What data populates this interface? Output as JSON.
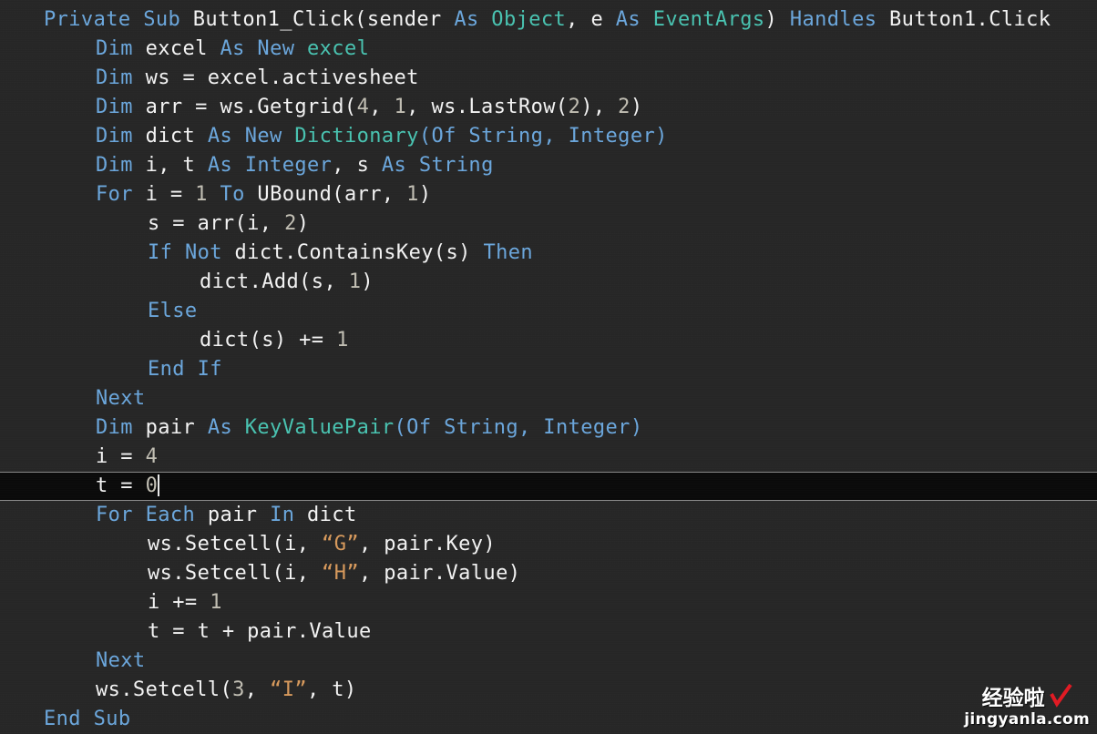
{
  "editor": {
    "language": "Visual Basic .NET",
    "background_color": "#262626",
    "default_text_color": "#f2f2f2",
    "keyword_color": "#6ba7dd",
    "type_color": "#49c3b1",
    "string_color": "#d89a5c",
    "number_color": "#c2bfb4",
    "current_line_background": "#0a0a0a",
    "current_line_border_color": "#8a8a8a",
    "caret_line_index": 15,
    "caret_column_after": "t = 0"
  },
  "code_lines": [
    {
      "indent": 0,
      "tokens": [
        {
          "t": "kw",
          "s": "Private"
        },
        {
          "t": "op",
          "s": " "
        },
        {
          "t": "kw",
          "s": "Sub"
        },
        {
          "t": "op",
          "s": " "
        },
        {
          "t": "id",
          "s": "Button1_Click(sender"
        },
        {
          "t": "op",
          "s": " "
        },
        {
          "t": "kw",
          "s": "As"
        },
        {
          "t": "op",
          "s": " "
        },
        {
          "t": "type",
          "s": "Object"
        },
        {
          "t": "id",
          "s": ", e"
        },
        {
          "t": "op",
          "s": " "
        },
        {
          "t": "kw",
          "s": "As"
        },
        {
          "t": "op",
          "s": " "
        },
        {
          "t": "type",
          "s": "EventArgs"
        },
        {
          "t": "id",
          "s": ")"
        },
        {
          "t": "op",
          "s": " "
        },
        {
          "t": "kw",
          "s": "Handles"
        },
        {
          "t": "op",
          "s": " "
        },
        {
          "t": "id",
          "s": "Button1.Click"
        }
      ]
    },
    {
      "indent": 1,
      "tokens": [
        {
          "t": "kw",
          "s": "Dim"
        },
        {
          "t": "id",
          "s": " excel "
        },
        {
          "t": "kw",
          "s": "As"
        },
        {
          "t": "op",
          "s": " "
        },
        {
          "t": "kw",
          "s": "New"
        },
        {
          "t": "op",
          "s": " "
        },
        {
          "t": "type",
          "s": "excel"
        }
      ]
    },
    {
      "indent": 1,
      "tokens": [
        {
          "t": "kw",
          "s": "Dim"
        },
        {
          "t": "id",
          "s": " ws = excel.activesheet"
        }
      ]
    },
    {
      "indent": 1,
      "tokens": [
        {
          "t": "kw",
          "s": "Dim"
        },
        {
          "t": "id",
          "s": " arr = ws.Getgrid("
        },
        {
          "t": "num",
          "s": "4"
        },
        {
          "t": "id",
          "s": ", "
        },
        {
          "t": "num",
          "s": "1"
        },
        {
          "t": "id",
          "s": ", ws.LastRow("
        },
        {
          "t": "num",
          "s": "2"
        },
        {
          "t": "id",
          "s": "), "
        },
        {
          "t": "num",
          "s": "2"
        },
        {
          "t": "id",
          "s": ")"
        }
      ]
    },
    {
      "indent": 1,
      "tokens": [
        {
          "t": "kw",
          "s": "Dim"
        },
        {
          "t": "id",
          "s": " dict "
        },
        {
          "t": "kw",
          "s": "As"
        },
        {
          "t": "op",
          "s": " "
        },
        {
          "t": "kw",
          "s": "New"
        },
        {
          "t": "op",
          "s": " "
        },
        {
          "t": "type",
          "s": "Dictionary"
        },
        {
          "t": "kw",
          "s": "("
        },
        {
          "t": "kw",
          "s": "Of"
        },
        {
          "t": "op",
          "s": " "
        },
        {
          "t": "kw",
          "s": "String"
        },
        {
          "t": "kw",
          "s": ", "
        },
        {
          "t": "kw",
          "s": "Integer"
        },
        {
          "t": "kw",
          "s": ")"
        }
      ]
    },
    {
      "indent": 1,
      "tokens": [
        {
          "t": "kw",
          "s": "Dim"
        },
        {
          "t": "id",
          "s": " i, t "
        },
        {
          "t": "kw",
          "s": "As"
        },
        {
          "t": "op",
          "s": " "
        },
        {
          "t": "kw",
          "s": "Integer"
        },
        {
          "t": "id",
          "s": ", s "
        },
        {
          "t": "kw",
          "s": "As"
        },
        {
          "t": "op",
          "s": " "
        },
        {
          "t": "kw",
          "s": "String"
        }
      ]
    },
    {
      "indent": 1,
      "tokens": [
        {
          "t": "kw",
          "s": "For"
        },
        {
          "t": "id",
          "s": " i = "
        },
        {
          "t": "num",
          "s": "1"
        },
        {
          "t": "op",
          "s": " "
        },
        {
          "t": "kw",
          "s": "To"
        },
        {
          "t": "id",
          "s": " UBound(arr, "
        },
        {
          "t": "num",
          "s": "1"
        },
        {
          "t": "id",
          "s": ")"
        }
      ]
    },
    {
      "indent": 2,
      "tokens": [
        {
          "t": "id",
          "s": "s = arr(i, "
        },
        {
          "t": "num",
          "s": "2"
        },
        {
          "t": "id",
          "s": ")"
        }
      ]
    },
    {
      "indent": 2,
      "tokens": [
        {
          "t": "kw",
          "s": "If"
        },
        {
          "t": "op",
          "s": " "
        },
        {
          "t": "kw",
          "s": "Not"
        },
        {
          "t": "id",
          "s": " dict.ContainsKey(s)"
        },
        {
          "t": "op",
          "s": " "
        },
        {
          "t": "kw",
          "s": "Then"
        }
      ]
    },
    {
      "indent": 3,
      "tokens": [
        {
          "t": "id",
          "s": "dict.Add(s, "
        },
        {
          "t": "num",
          "s": "1"
        },
        {
          "t": "id",
          "s": ")"
        }
      ]
    },
    {
      "indent": 2,
      "tokens": [
        {
          "t": "kw",
          "s": "Else"
        }
      ]
    },
    {
      "indent": 3,
      "tokens": [
        {
          "t": "id",
          "s": "dict(s) += "
        },
        {
          "t": "num",
          "s": "1"
        }
      ]
    },
    {
      "indent": 2,
      "tokens": [
        {
          "t": "kw",
          "s": "End"
        },
        {
          "t": "op",
          "s": " "
        },
        {
          "t": "kw",
          "s": "If"
        }
      ]
    },
    {
      "indent": 1,
      "tokens": [
        {
          "t": "kw",
          "s": "Next"
        }
      ]
    },
    {
      "indent": 1,
      "tokens": [
        {
          "t": "kw",
          "s": "Dim"
        },
        {
          "t": "id",
          "s": " pair "
        },
        {
          "t": "kw",
          "s": "As"
        },
        {
          "t": "op",
          "s": " "
        },
        {
          "t": "type",
          "s": "KeyValuePair"
        },
        {
          "t": "kw",
          "s": "("
        },
        {
          "t": "kw",
          "s": "Of"
        },
        {
          "t": "op",
          "s": " "
        },
        {
          "t": "kw",
          "s": "String"
        },
        {
          "t": "kw",
          "s": ", "
        },
        {
          "t": "kw",
          "s": "Integer"
        },
        {
          "t": "kw",
          "s": ")"
        }
      ]
    },
    {
      "indent": 1,
      "tokens": [
        {
          "t": "id",
          "s": "i = "
        },
        {
          "t": "num",
          "s": "4"
        }
      ]
    },
    {
      "indent": 1,
      "current": true,
      "caret": true,
      "tokens": [
        {
          "t": "id",
          "s": "t = "
        },
        {
          "t": "num",
          "s": "0"
        }
      ]
    },
    {
      "indent": 1,
      "tokens": [
        {
          "t": "kw",
          "s": "For"
        },
        {
          "t": "op",
          "s": " "
        },
        {
          "t": "kw",
          "s": "Each"
        },
        {
          "t": "id",
          "s": " pair"
        },
        {
          "t": "op",
          "s": " "
        },
        {
          "t": "kw",
          "s": "In"
        },
        {
          "t": "id",
          "s": " dict"
        }
      ]
    },
    {
      "indent": 2,
      "tokens": [
        {
          "t": "id",
          "s": "ws.Setcell(i, "
        },
        {
          "t": "str",
          "s": "“G”"
        },
        {
          "t": "id",
          "s": ", pair.Key)"
        }
      ]
    },
    {
      "indent": 2,
      "tokens": [
        {
          "t": "id",
          "s": "ws.Setcell(i, "
        },
        {
          "t": "str",
          "s": "“H”"
        },
        {
          "t": "id",
          "s": ", pair.Value)"
        }
      ]
    },
    {
      "indent": 2,
      "tokens": [
        {
          "t": "id",
          "s": "i += "
        },
        {
          "t": "num",
          "s": "1"
        }
      ]
    },
    {
      "indent": 2,
      "tokens": [
        {
          "t": "id",
          "s": "t = t + pair.Value"
        }
      ]
    },
    {
      "indent": 1,
      "tokens": [
        {
          "t": "kw",
          "s": "Next"
        }
      ]
    },
    {
      "indent": 1,
      "tokens": [
        {
          "t": "id",
          "s": "ws.Setcell("
        },
        {
          "t": "num",
          "s": "3"
        },
        {
          "t": "id",
          "s": ", "
        },
        {
          "t": "str",
          "s": "“I”"
        },
        {
          "t": "id",
          "s": ", t)"
        }
      ]
    },
    {
      "indent": 0,
      "tokens": [
        {
          "t": "kw",
          "s": "End"
        },
        {
          "t": "op",
          "s": " "
        },
        {
          "t": "kw",
          "s": "Sub"
        }
      ]
    }
  ],
  "watermark": {
    "brand_cn": "经验啦",
    "domain": "jingyanla.com",
    "check_icon": "red-check-icon",
    "check_color": "#e01b24"
  }
}
